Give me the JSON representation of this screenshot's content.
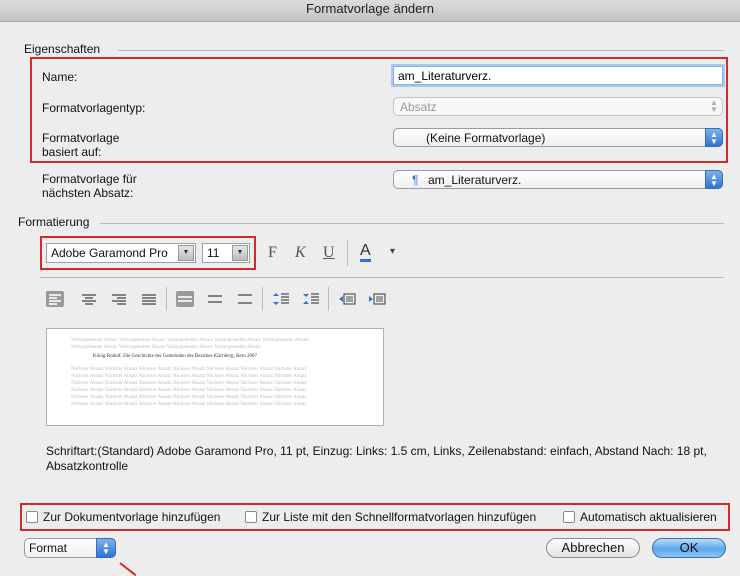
{
  "window": {
    "title": "Formatvorlage ändern"
  },
  "eigenschaften": {
    "section_label": "Eigenschaften",
    "name_label": "Name:",
    "name_value": "am_Literaturverz.",
    "typ_label": "Formatvorlagentyp:",
    "typ_value": "Absatz",
    "basiert_label_1": "Formatvorlage",
    "basiert_label_2": "basiert auf:",
    "basiert_value": "(Keine Formatvorlage)",
    "naechster_label_1": "Formatvorlage für",
    "naechster_label_2": "nächsten Absatz:",
    "naechster_icon": "¶",
    "naechster_value": "am_Literaturverz."
  },
  "formatierung": {
    "section_label": "Formatierung",
    "font_name": "Adobe Garamond Pro",
    "font_size": "11",
    "bold_label": "F",
    "italic_label": "K",
    "underline_label": "U",
    "font_color_label": "A",
    "font_color_arrow": "▾"
  },
  "preview": {
    "prev_text_1": "Vorhergehender Absatz Vorhergehender Absatz Vorhergehender Absatz Vorhergehender Absatz Vorhergehender Absatz",
    "prev_text_2": "Vorhergehender Absatz Vorhergehender Absatz Vorhergehender Absatz Vorhergehender Absatz",
    "main_text": "König Rudolf, Die Geschichte der Gemeinden des Bezirkes Kilchberg, Bern 2007",
    "next_text": "Nächster Absatz Nächster Absatz Nächster Absatz Nächster Absatz Nächster Absatz Nächster Absatz Nächster Absatz"
  },
  "description": "Schriftart:(Standard) Adobe Garamond Pro, 11 pt, Einzug: Links:  1.5 cm, Links, Zeilenabstand:  einfach, Abstand Nach:  18 pt, Absatzkontrolle",
  "options": {
    "add_template": "Zur Dokumentvorlage hinzufügen",
    "add_quick_list": "Zur Liste mit den Schnellformatvorlagen hinzufügen",
    "auto_update": "Automatisch aktualisieren"
  },
  "footer": {
    "format_label": "Format",
    "cancel_label": "Abbrechen",
    "ok_label": "OK"
  },
  "colors": {
    "highlight_red": "#d42a2a",
    "accent_blue": "#2f73d2"
  }
}
